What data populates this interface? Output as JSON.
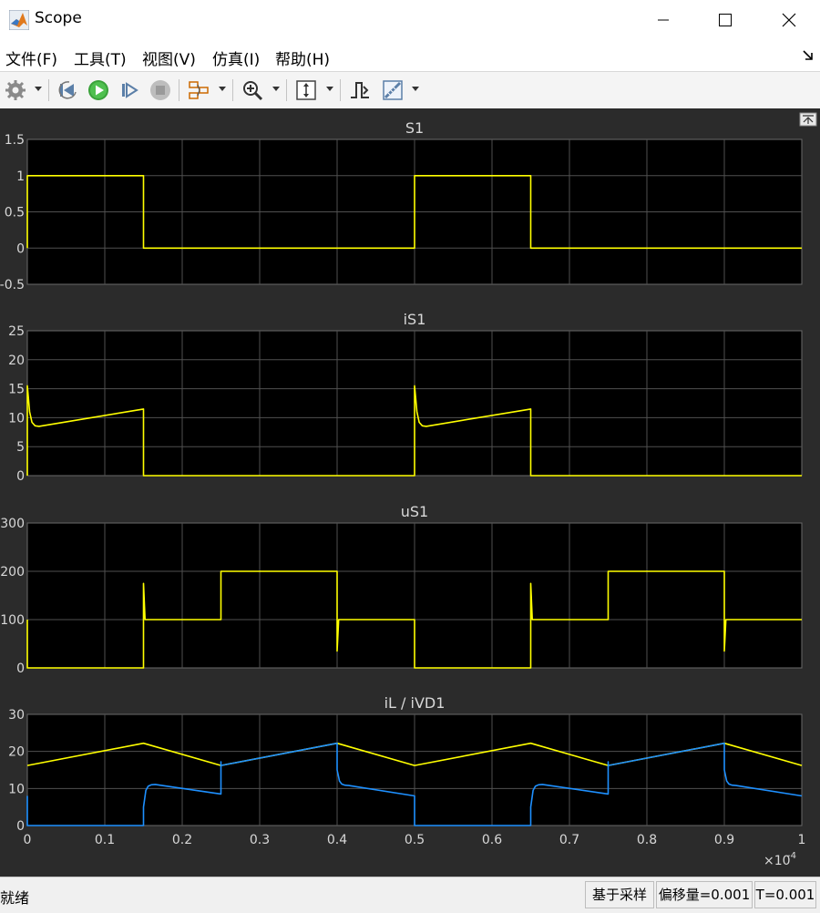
{
  "window": {
    "title": "Scope",
    "minimize_icon": "minimize-icon",
    "maximize_icon": "maximize-icon",
    "close_icon": "close-icon"
  },
  "menu": {
    "items": [
      "文件(F)",
      "工具(T)",
      "视图(V)",
      "仿真(I)",
      "帮助(H)"
    ]
  },
  "toolbar": {
    "icons": [
      "settings-gear-icon",
      "step-back-icon",
      "run-icon",
      "step-forward-icon",
      "stop-icon",
      "signal-selector-icon",
      "zoom-in-icon",
      "autoscale-icon",
      "triggers-icon",
      "cursor-measurements-icon"
    ]
  },
  "status": {
    "left": "就绪",
    "cells": [
      "基于采样",
      "偏移量=0.001",
      "T=0.001"
    ]
  },
  "colors": {
    "signal1": "#ffff00",
    "signal2": "#1e90ff",
    "plot_bg": "#000000",
    "figure_bg": "#2b2b2b",
    "grid": "#505050",
    "text": "#d8d8d8"
  },
  "chart_data": [
    {
      "type": "line",
      "title": "S1",
      "ylim": [
        -0.5,
        1.5
      ],
      "yticks": [
        "-0.5",
        "0",
        "0.5",
        "1",
        "1.5"
      ],
      "series": [
        {
          "color": "#ffff00",
          "x": [
            0,
            0,
            0.15,
            0.15,
            0.5,
            0.5,
            0.65,
            0.65,
            1
          ],
          "y": [
            0,
            1,
            1,
            0,
            0,
            1,
            1,
            0,
            0
          ]
        }
      ]
    },
    {
      "type": "line",
      "title": "iS1",
      "ylim": [
        0,
        25
      ],
      "yticks": [
        "0",
        "5",
        "10",
        "15",
        "20",
        "25"
      ],
      "series": [
        {
          "color": "#ffff00",
          "x": [
            0,
            0,
            0.003,
            0.006,
            0.01,
            0.015,
            0.15,
            0.15,
            0.5,
            0.5,
            0.503,
            0.506,
            0.51,
            0.515,
            0.65,
            0.65,
            1
          ],
          "y": [
            0,
            15.5,
            11,
            9.2,
            8.6,
            8.5,
            11.5,
            0,
            0,
            15.5,
            11,
            9.2,
            8.6,
            8.5,
            11.5,
            0,
            0
          ]
        }
      ]
    },
    {
      "type": "line",
      "title": "uS1",
      "ylim": [
        0,
        300
      ],
      "yticks": [
        "0",
        "100",
        "200",
        "300"
      ],
      "series": [
        {
          "color": "#ffff00",
          "x": [
            0,
            0,
            0.15,
            0.15,
            0.152,
            0.25,
            0.25,
            0.4,
            0.4,
            0.402,
            0.5,
            0.5,
            0.65,
            0.65,
            0.652,
            0.75,
            0.75,
            0.9,
            0.9,
            0.902,
            1
          ],
          "y": [
            100,
            0,
            0,
            175,
            100,
            100,
            200,
            200,
            35,
            100,
            100,
            0,
            0,
            175,
            100,
            100,
            200,
            200,
            35,
            100,
            100
          ]
        }
      ]
    },
    {
      "type": "line",
      "title": "iL / iVD1",
      "ylim": [
        0,
        30
      ],
      "yticks": [
        "0",
        "10",
        "20",
        "30"
      ],
      "xlim": [
        0,
        1
      ],
      "xticks": [
        "0",
        "0.1",
        "0.2",
        "0.3",
        "0.4",
        "0.5",
        "0.6",
        "0.7",
        "0.8",
        "0.9",
        "1"
      ],
      "x_multiplier": "×10",
      "x_exponent": "-4",
      "series": [
        {
          "color": "#ffff00",
          "x": [
            0,
            0.15,
            0.25,
            0.4,
            0.5,
            0.65,
            0.75,
            0.9,
            1
          ],
          "y": [
            16.2,
            22.2,
            16.2,
            22.2,
            16.2,
            22.2,
            16.2,
            22.2,
            16.2
          ]
        },
        {
          "color": "#1e90ff",
          "x": [
            0,
            0,
            0.002,
            0.15,
            0.15,
            0.153,
            0.156,
            0.16,
            0.165,
            0.25,
            0.25,
            0.25,
            0.4,
            0.4,
            0.403,
            0.406,
            0.41,
            0.415,
            0.5,
            0.5,
            0.65,
            0.65,
            0.653,
            0.656,
            0.66,
            0.665,
            0.75,
            0.75,
            0.75,
            0.9,
            0.9,
            0.903,
            0.906,
            0.91,
            0.915,
            1
          ],
          "y": [
            8,
            0,
            0,
            0,
            5,
            9.5,
            10.6,
            11,
            11.1,
            8.5,
            17.2,
            16.2,
            22.2,
            15,
            12,
            11.2,
            10.9,
            10.8,
            8,
            0,
            0,
            5,
            9.5,
            10.6,
            11,
            11.1,
            8.5,
            17.2,
            16.2,
            22.2,
            15,
            12,
            11.2,
            10.9,
            10.8,
            8
          ]
        }
      ]
    }
  ]
}
